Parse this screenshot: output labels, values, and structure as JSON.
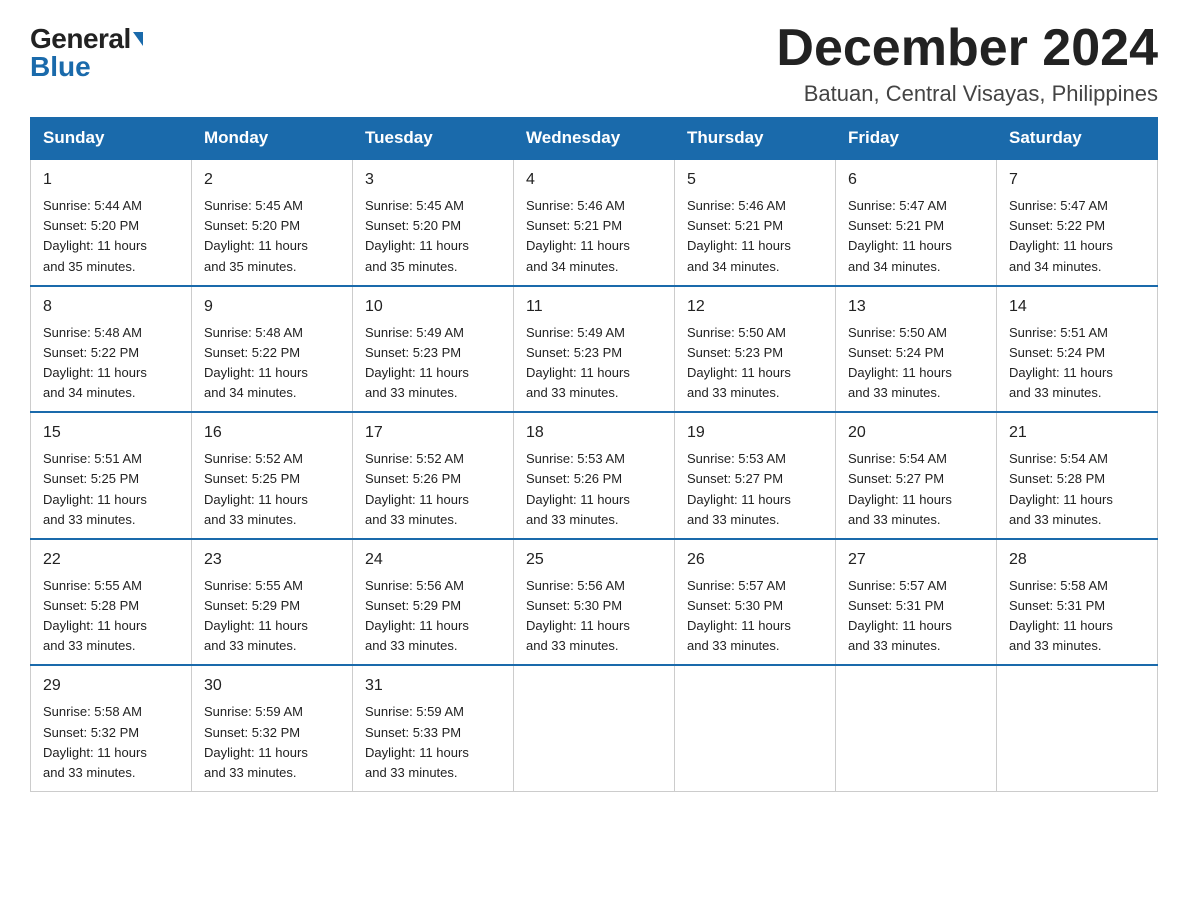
{
  "logo": {
    "general": "General",
    "blue": "Blue"
  },
  "header": {
    "month": "December 2024",
    "location": "Batuan, Central Visayas, Philippines"
  },
  "weekdays": [
    "Sunday",
    "Monday",
    "Tuesday",
    "Wednesday",
    "Thursday",
    "Friday",
    "Saturday"
  ],
  "weeks": [
    [
      {
        "day": "1",
        "sunrise": "5:44 AM",
        "sunset": "5:20 PM",
        "daylight": "11 hours and 35 minutes."
      },
      {
        "day": "2",
        "sunrise": "5:45 AM",
        "sunset": "5:20 PM",
        "daylight": "11 hours and 35 minutes."
      },
      {
        "day": "3",
        "sunrise": "5:45 AM",
        "sunset": "5:20 PM",
        "daylight": "11 hours and 35 minutes."
      },
      {
        "day": "4",
        "sunrise": "5:46 AM",
        "sunset": "5:21 PM",
        "daylight": "11 hours and 34 minutes."
      },
      {
        "day": "5",
        "sunrise": "5:46 AM",
        "sunset": "5:21 PM",
        "daylight": "11 hours and 34 minutes."
      },
      {
        "day": "6",
        "sunrise": "5:47 AM",
        "sunset": "5:21 PM",
        "daylight": "11 hours and 34 minutes."
      },
      {
        "day": "7",
        "sunrise": "5:47 AM",
        "sunset": "5:22 PM",
        "daylight": "11 hours and 34 minutes."
      }
    ],
    [
      {
        "day": "8",
        "sunrise": "5:48 AM",
        "sunset": "5:22 PM",
        "daylight": "11 hours and 34 minutes."
      },
      {
        "day": "9",
        "sunrise": "5:48 AM",
        "sunset": "5:22 PM",
        "daylight": "11 hours and 34 minutes."
      },
      {
        "day": "10",
        "sunrise": "5:49 AM",
        "sunset": "5:23 PM",
        "daylight": "11 hours and 33 minutes."
      },
      {
        "day": "11",
        "sunrise": "5:49 AM",
        "sunset": "5:23 PM",
        "daylight": "11 hours and 33 minutes."
      },
      {
        "day": "12",
        "sunrise": "5:50 AM",
        "sunset": "5:23 PM",
        "daylight": "11 hours and 33 minutes."
      },
      {
        "day": "13",
        "sunrise": "5:50 AM",
        "sunset": "5:24 PM",
        "daylight": "11 hours and 33 minutes."
      },
      {
        "day": "14",
        "sunrise": "5:51 AM",
        "sunset": "5:24 PM",
        "daylight": "11 hours and 33 minutes."
      }
    ],
    [
      {
        "day": "15",
        "sunrise": "5:51 AM",
        "sunset": "5:25 PM",
        "daylight": "11 hours and 33 minutes."
      },
      {
        "day": "16",
        "sunrise": "5:52 AM",
        "sunset": "5:25 PM",
        "daylight": "11 hours and 33 minutes."
      },
      {
        "day": "17",
        "sunrise": "5:52 AM",
        "sunset": "5:26 PM",
        "daylight": "11 hours and 33 minutes."
      },
      {
        "day": "18",
        "sunrise": "5:53 AM",
        "sunset": "5:26 PM",
        "daylight": "11 hours and 33 minutes."
      },
      {
        "day": "19",
        "sunrise": "5:53 AM",
        "sunset": "5:27 PM",
        "daylight": "11 hours and 33 minutes."
      },
      {
        "day": "20",
        "sunrise": "5:54 AM",
        "sunset": "5:27 PM",
        "daylight": "11 hours and 33 minutes."
      },
      {
        "day": "21",
        "sunrise": "5:54 AM",
        "sunset": "5:28 PM",
        "daylight": "11 hours and 33 minutes."
      }
    ],
    [
      {
        "day": "22",
        "sunrise": "5:55 AM",
        "sunset": "5:28 PM",
        "daylight": "11 hours and 33 minutes."
      },
      {
        "day": "23",
        "sunrise": "5:55 AM",
        "sunset": "5:29 PM",
        "daylight": "11 hours and 33 minutes."
      },
      {
        "day": "24",
        "sunrise": "5:56 AM",
        "sunset": "5:29 PM",
        "daylight": "11 hours and 33 minutes."
      },
      {
        "day": "25",
        "sunrise": "5:56 AM",
        "sunset": "5:30 PM",
        "daylight": "11 hours and 33 minutes."
      },
      {
        "day": "26",
        "sunrise": "5:57 AM",
        "sunset": "5:30 PM",
        "daylight": "11 hours and 33 minutes."
      },
      {
        "day": "27",
        "sunrise": "5:57 AM",
        "sunset": "5:31 PM",
        "daylight": "11 hours and 33 minutes."
      },
      {
        "day": "28",
        "sunrise": "5:58 AM",
        "sunset": "5:31 PM",
        "daylight": "11 hours and 33 minutes."
      }
    ],
    [
      {
        "day": "29",
        "sunrise": "5:58 AM",
        "sunset": "5:32 PM",
        "daylight": "11 hours and 33 minutes."
      },
      {
        "day": "30",
        "sunrise": "5:59 AM",
        "sunset": "5:32 PM",
        "daylight": "11 hours and 33 minutes."
      },
      {
        "day": "31",
        "sunrise": "5:59 AM",
        "sunset": "5:33 PM",
        "daylight": "11 hours and 33 minutes."
      },
      null,
      null,
      null,
      null
    ]
  ],
  "labels": {
    "sunrise": "Sunrise:",
    "sunset": "Sunset:",
    "daylight": "Daylight:"
  }
}
